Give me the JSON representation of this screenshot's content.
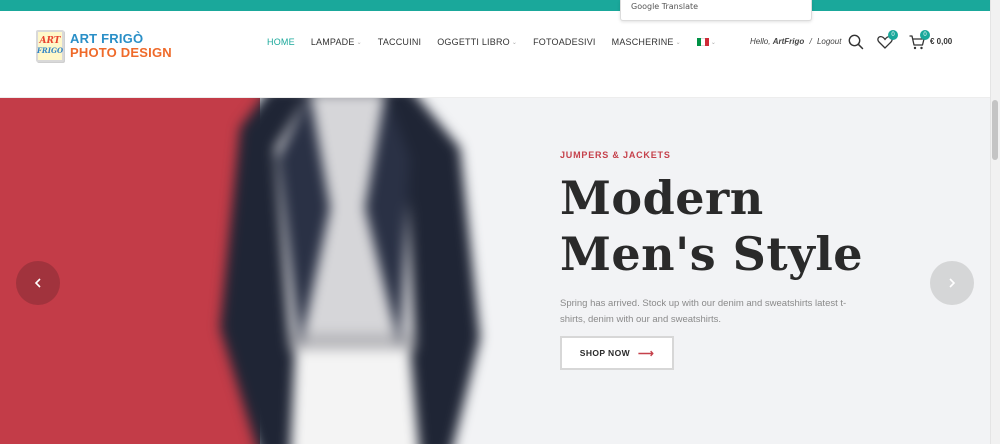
{
  "google_translate": {
    "label": "Google Translate"
  },
  "header": {
    "logo": {
      "line1": "ART FRIGÒ",
      "line2": "PHOTO DESIGN",
      "badge_top": "ART",
      "badge_bottom": "FRIGO"
    },
    "nav": [
      {
        "label": "HOME",
        "active": true,
        "has_dropdown": false
      },
      {
        "label": "LAMPADE",
        "active": false,
        "has_dropdown": true
      },
      {
        "label": "TACCUINI",
        "active": false,
        "has_dropdown": false
      },
      {
        "label": "OGGETTI LIBRO",
        "active": false,
        "has_dropdown": true
      },
      {
        "label": "FOTOADESIVI",
        "active": false,
        "has_dropdown": false
      },
      {
        "label": "MASCHERINE",
        "active": false,
        "has_dropdown": true
      }
    ],
    "language": {
      "flag": "italy-flag",
      "has_dropdown": true
    },
    "account": {
      "greeting": "Hello,",
      "username": "ArtFrigo",
      "separator": "/",
      "logout": "Logout"
    },
    "wishlist_count": "0",
    "cart_count": "0",
    "cart_total": "€ 0,00"
  },
  "hero": {
    "kicker": "JUMPERS & JACKETS",
    "title_line1": "Modern",
    "title_line2": "Men's Style",
    "description": "Spring has arrived. Stock up with our denim and sweatshirts latest t-shirts, denim with our and sweatshirts.",
    "button_label": "SHOP NOW",
    "button_arrow": "⟶",
    "prev_icon": "chevron-left-icon",
    "next_icon": "chevron-right-icon"
  },
  "colors": {
    "accent": "#1aa89b",
    "hero_red": "#c33c48",
    "kicker": "#c5414b"
  }
}
